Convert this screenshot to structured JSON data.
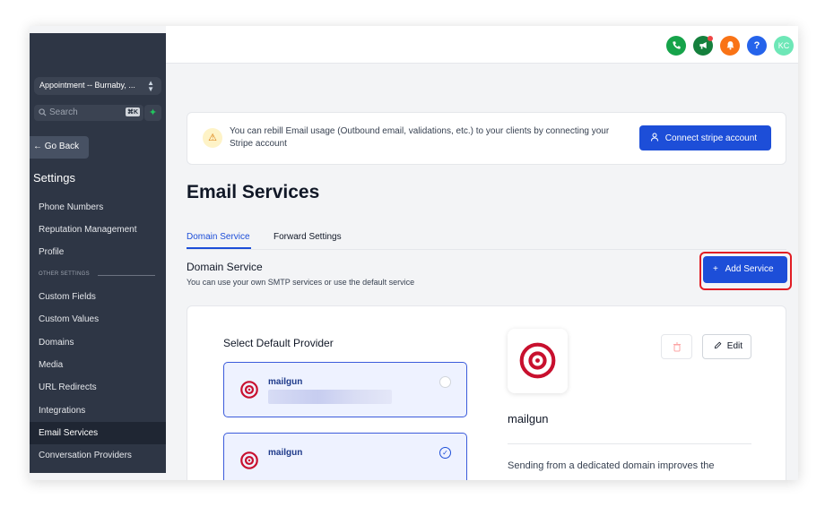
{
  "sidebar": {
    "location": "Appointment -- Burnaby, ...",
    "search_placeholder": "Search",
    "search_shortcut": "⌘K",
    "back_label": "Go Back",
    "settings_title": "Settings",
    "items_top": [
      "Phone Numbers",
      "Reputation Management",
      "Profile"
    ],
    "other_settings_label": "OTHER SETTINGS",
    "items_other": [
      "Custom Fields",
      "Custom Values",
      "Domains",
      "Media",
      "URL Redirects",
      "Integrations",
      "Email Services",
      "Conversation Providers"
    ],
    "active_item": "Email Services"
  },
  "topbar": {
    "avatar_initials": "KC",
    "help_glyph": "?",
    "colors": {
      "phone": "#16a34a",
      "megaphone": "#15803d",
      "bell": "#f97316",
      "help": "#2563eb",
      "avatar": "#6ee7b7"
    }
  },
  "banner": {
    "text": "You can rebill Email usage (Outbound email, validations, etc.) to your clients by connecting your Stripe account",
    "button_label": "Connect stripe account"
  },
  "page": {
    "title": "Email Services",
    "tabs": [
      "Domain Service",
      "Forward Settings"
    ],
    "active_tab": "Domain Service",
    "section_title": "Domain Service",
    "section_subtitle": "You can use your own SMTP services or use the default service",
    "add_button_label": "Add Service"
  },
  "providers": {
    "heading": "Select Default Provider",
    "list": [
      {
        "name": "mailgun",
        "selected": false
      },
      {
        "name": "mailgun",
        "selected": true
      }
    ]
  },
  "detail": {
    "name": "mailgun",
    "edit_label": "Edit",
    "description": "Sending from a dedicated domain improves the"
  },
  "colors": {
    "brand_blue": "#1d4ed8",
    "sidebar_bg": "#2e3645",
    "highlight_red": "#e11d24",
    "mailgun_red": "#c8102e"
  }
}
